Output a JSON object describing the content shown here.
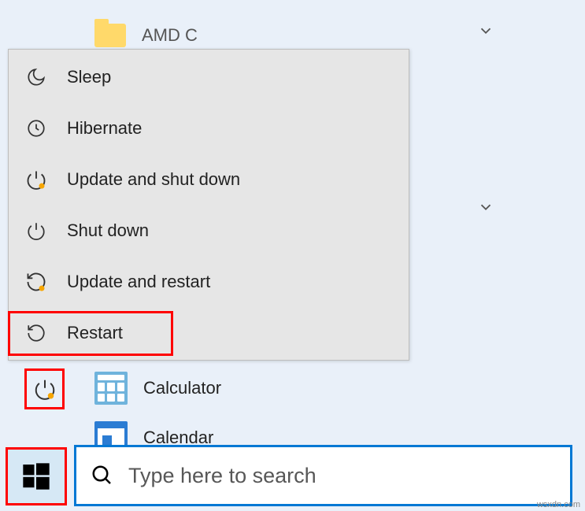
{
  "folder": {
    "label": "AMD C"
  },
  "power_menu": {
    "items": [
      {
        "key": "sleep",
        "label": "Sleep"
      },
      {
        "key": "hibernate",
        "label": "Hibernate"
      },
      {
        "key": "update-shutdown",
        "label": "Update and shut down"
      },
      {
        "key": "shutdown",
        "label": "Shut down"
      },
      {
        "key": "update-restart",
        "label": "Update and restart"
      },
      {
        "key": "restart",
        "label": "Restart"
      }
    ]
  },
  "apps": {
    "calculator": "Calculator",
    "calendar": "Calendar"
  },
  "search": {
    "placeholder": "Type here to search"
  },
  "watermark": "wsxdn.com",
  "colors": {
    "highlight": "#ff0000",
    "accent": "#0078d4",
    "menu_bg": "#e6e6e6",
    "bg": "#e9f0f9"
  }
}
